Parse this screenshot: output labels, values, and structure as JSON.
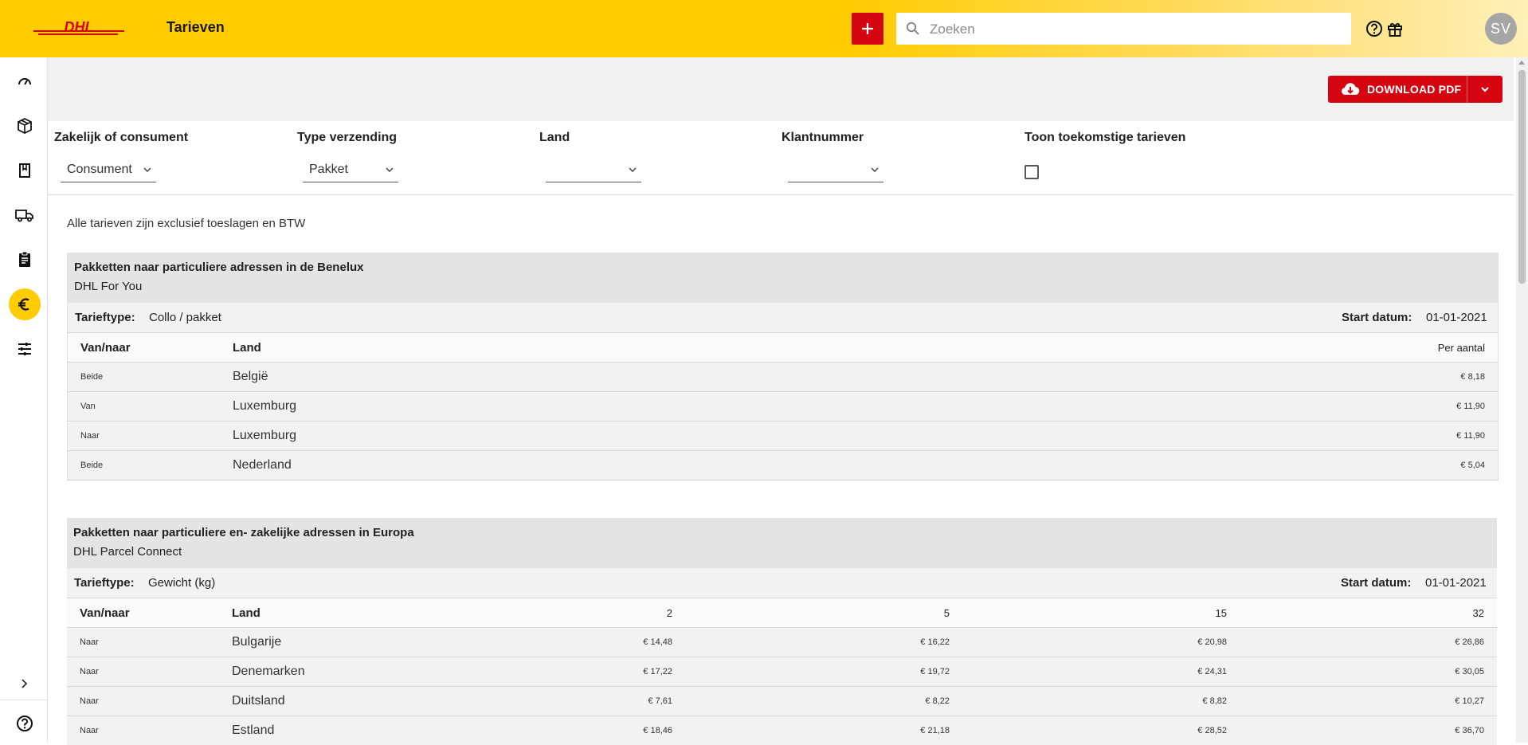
{
  "header": {
    "logo_text": "DHL",
    "title": "Tarieven",
    "search_placeholder": "Zoeken",
    "avatar_initials": "SV",
    "brand_color": "#ffcc00",
    "accent_color": "#d40511"
  },
  "sidebar": {
    "items": [
      {
        "icon": "speedometer-icon",
        "active": false
      },
      {
        "icon": "package-icon",
        "active": false
      },
      {
        "icon": "book-icon",
        "active": false
      },
      {
        "icon": "truck-icon",
        "active": false
      },
      {
        "icon": "clipboard-icon",
        "active": false
      },
      {
        "icon": "euro-icon",
        "active": true
      },
      {
        "icon": "sliders-icon",
        "active": false
      }
    ],
    "expand_icon": "chevron-right-icon",
    "help_icon": "help-circle-icon"
  },
  "toolbar": {
    "download_label": "DOWNLOAD PDF"
  },
  "filters": {
    "business_label": "Zakelijk of consument",
    "business_value": "Consument",
    "shipment_label": "Type verzending",
    "shipment_value": "Pakket",
    "country_label": "Land",
    "country_value": "",
    "customer_label": "Klantnummer",
    "customer_value": "",
    "future_label": "Toon toekomstige tarieven",
    "future_checked": false
  },
  "note": "Alle tarieven zijn exclusief toeslagen en BTW",
  "sections": [
    {
      "title": "Pakketten naar particuliere adressen in de Benelux",
      "subtitle": "DHL For You",
      "tariff_type_label": "Tarieftype:",
      "tariff_type": "Collo / pakket",
      "start_label": "Start datum:",
      "start_date": "01-01-2021",
      "col_dir": "Van/naar",
      "col_land": "Land",
      "price_cols": [
        "Per aantal"
      ],
      "rows": [
        {
          "dir": "Beide",
          "land": "België",
          "prices": [
            "€ 8,18"
          ]
        },
        {
          "dir": "Van",
          "land": "Luxemburg",
          "prices": [
            "€ 11,90"
          ]
        },
        {
          "dir": "Naar",
          "land": "Luxemburg",
          "prices": [
            "€ 11,90"
          ]
        },
        {
          "dir": "Beide",
          "land": "Nederland",
          "prices": [
            "€ 5,04"
          ]
        }
      ]
    },
    {
      "title": "Pakketten naar particuliere en- zakelijke adressen in Europa",
      "subtitle": "DHL Parcel Connect",
      "tariff_type_label": "Tarieftype:",
      "tariff_type": "Gewicht (kg)",
      "start_label": "Start datum:",
      "start_date": "01-01-2021",
      "col_dir": "Van/naar",
      "col_land": "Land",
      "price_cols": [
        "2",
        "5",
        "15",
        "32"
      ],
      "rows": [
        {
          "dir": "Naar",
          "land": "Bulgarije",
          "prices": [
            "€ 14,48",
            "€ 16,22",
            "€ 20,98",
            "€ 26,86"
          ]
        },
        {
          "dir": "Naar",
          "land": "Denemarken",
          "prices": [
            "€ 17,22",
            "€ 19,72",
            "€ 24,31",
            "€ 30,05"
          ]
        },
        {
          "dir": "Naar",
          "land": "Duitsland",
          "prices": [
            "€ 7,61",
            "€ 8,22",
            "€ 8,82",
            "€ 10,27"
          ]
        },
        {
          "dir": "Naar",
          "land": "Estland",
          "prices": [
            "€ 18,46",
            "€ 21,18",
            "€ 28,52",
            "€ 36,70"
          ]
        }
      ]
    }
  ]
}
